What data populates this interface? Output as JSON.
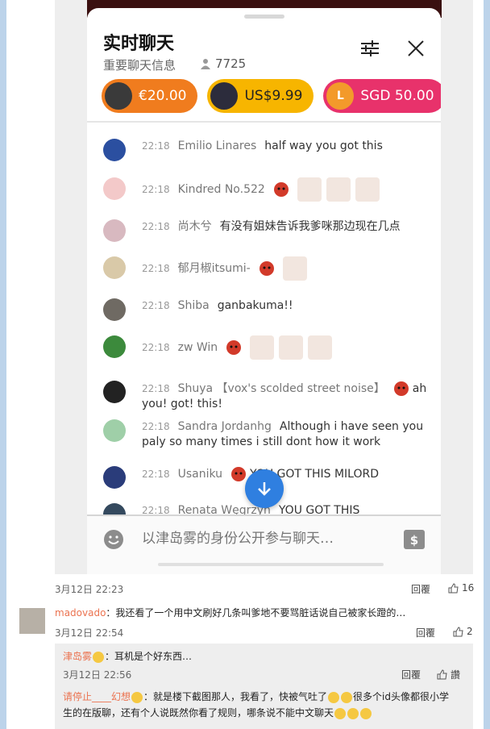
{
  "chat": {
    "title": "实时聊天",
    "subtitle": "重要聊天信息",
    "viewer_count": "7725",
    "tips": [
      {
        "label": "€20.00",
        "color": "#f07c1e"
      },
      {
        "label": "US$9.99",
        "color": "#f7b500"
      },
      {
        "label": "SGD 50.00",
        "avatar_letter": "L",
        "color": "#e8326b"
      }
    ],
    "messages": [
      {
        "time": "22:18",
        "name": "Emilio Linares",
        "text": "half way you got this",
        "avatar_color": "#2b4fa0"
      },
      {
        "time": "22:18",
        "name": "Kindred No.522",
        "text": "",
        "avatar_color": "#f3c9c9"
      },
      {
        "time": "22:18",
        "name": "尚木兮",
        "text": "有没有姐妹告诉我爹咪那边现在几点",
        "avatar_color": "#d8b9c0"
      },
      {
        "time": "22:18",
        "name": "郁月椒itsumi-",
        "text": "",
        "avatar_color": "#d9c9a8"
      },
      {
        "time": "22:18",
        "name": "Shiba",
        "text": "ganbakuma!!",
        "avatar_color": "#6f6a63"
      },
      {
        "time": "22:18",
        "name": "zw Win",
        "text": "",
        "avatar_color": "#3c8a3c"
      },
      {
        "time": "22:18",
        "name": "Shuya 【vox's scolded street noise】",
        "text": "ah you! got! this!",
        "avatar_color": "#222222"
      },
      {
        "time": "22:18",
        "name": "Sandra Jordanhg",
        "text": "Although i have seen you paly so many times i still dont how it work",
        "avatar_color": "#9fcfa8"
      },
      {
        "time": "22:18",
        "name": "Usaniku",
        "text": "YOU GOT THIS MILORD",
        "avatar_color": "#2a3c7a"
      },
      {
        "time": "22:18",
        "name": "Renata Węgrzyn",
        "text": "YOU GOT THIS",
        "avatar_color": "#34495e"
      }
    ],
    "input_placeholder": "以津岛雾的身份公开参与聊天…"
  },
  "post": {
    "date": "3月12日 22:23",
    "reply_label": "回覆",
    "like_count": "16"
  },
  "comment": {
    "user": "madovado",
    "text": "：我还看了一个用中文刷好几条叫爹地不要骂脏话说自己被家长蹬的…",
    "date": "3月12日 22:54",
    "reply_label": "回覆",
    "like_count": "2"
  },
  "sub_replies": [
    {
      "user": "津岛雾",
      "text": "：耳机是个好东西…",
      "date": "3月12日 22:56",
      "reply_label": "回覆",
      "like_label": "讚"
    },
    {
      "user": "请停止____幻想",
      "text_line1": "：就是楼下截图那人，我看了，快被气吐了",
      "text_line1b": "很多个id头像都很小学",
      "text_line2": "生的在版聊，还有个人说既然你看了规则，哪条说不能中文聊天"
    }
  ],
  "colors": {
    "accent_blue": "#2f7fe0",
    "weibo_orange": "#eb7350",
    "stripe": "#bcd3ea"
  }
}
